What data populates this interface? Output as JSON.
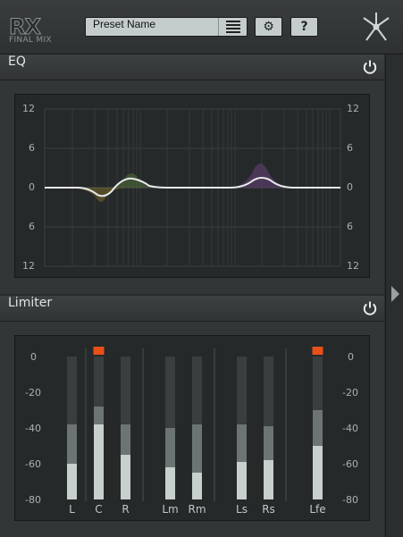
{
  "header": {
    "logo_main": "RX",
    "logo_sub": "FINAL MIX",
    "preset_name": "Preset Name",
    "settings_label": "⚙",
    "help_label": "?"
  },
  "eq": {
    "title": "EQ",
    "y_ticks_left": [
      "12",
      "6",
      "0",
      "6",
      "12"
    ],
    "y_ticks_right": [
      "12",
      "6",
      "0",
      "6",
      "12"
    ]
  },
  "limiter": {
    "title": "Limiter",
    "scale_left": [
      "0",
      "-20",
      "-40",
      "-60",
      "-80"
    ],
    "scale_right": [
      "0",
      "-20",
      "-40",
      "-60",
      "-80"
    ],
    "clip_color": "#e8501a"
  },
  "chart_data": {
    "type": "bar",
    "categories": [
      "L",
      "C",
      "R",
      "Lm",
      "Rm",
      "Ls",
      "Rs",
      "Lfe"
    ],
    "series": [
      {
        "values": [
          -60,
          -38,
          -55,
          -62,
          -65,
          -59,
          -58,
          -50
        ]
      },
      {
        "values": [
          -38,
          -28,
          -38,
          -40,
          -38,
          -38,
          -39,
          -30
        ]
      }
    ],
    "clip": [
      false,
      true,
      false,
      false,
      false,
      false,
      false,
      true
    ],
    "ylim": [
      -80,
      0
    ]
  }
}
